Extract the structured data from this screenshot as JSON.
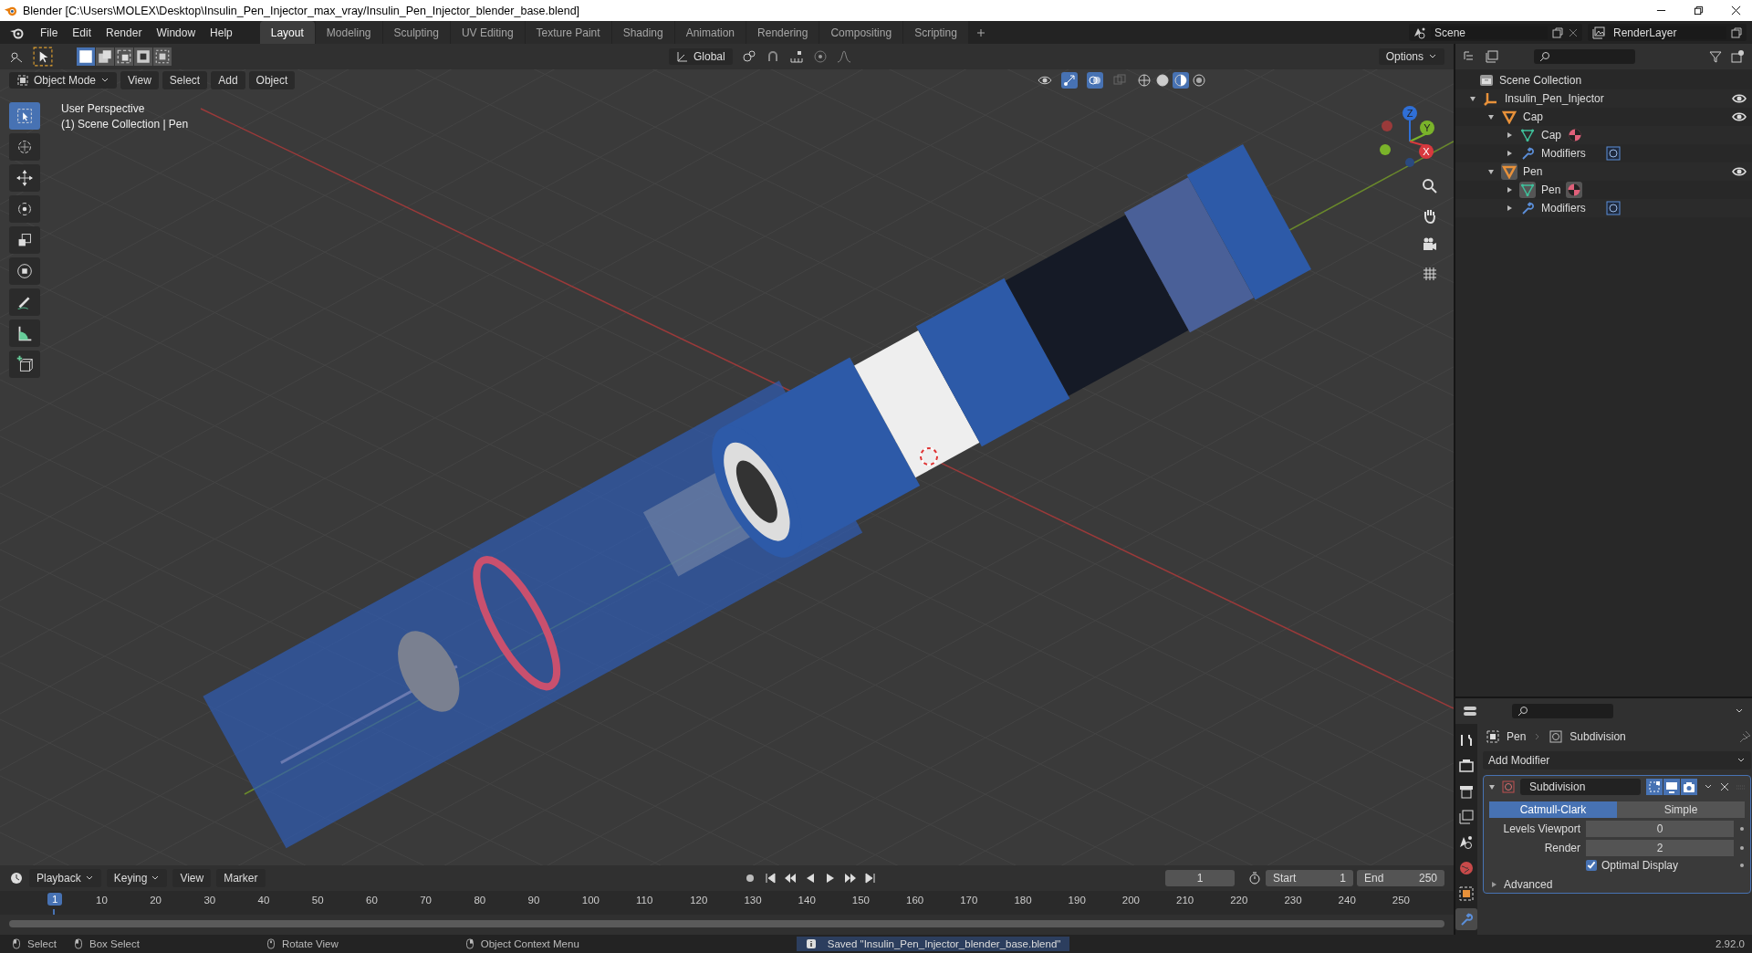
{
  "window": {
    "title": "Blender [C:\\Users\\MOLEX\\Desktop\\Insulin_Pen_Injector_max_vray/Insulin_Pen_Injector_blender_base.blend]"
  },
  "menu": [
    "File",
    "Edit",
    "Render",
    "Window",
    "Help"
  ],
  "workspace_tabs": [
    {
      "label": "Layout",
      "selected": true
    },
    {
      "label": "Modeling",
      "selected": false
    },
    {
      "label": "Sculpting",
      "selected": false
    },
    {
      "label": "UV Editing",
      "selected": false
    },
    {
      "label": "Texture Paint",
      "selected": false
    },
    {
      "label": "Shading",
      "selected": false
    },
    {
      "label": "Animation",
      "selected": false
    },
    {
      "label": "Rendering",
      "selected": false
    },
    {
      "label": "Compositing",
      "selected": false
    },
    {
      "label": "Scripting",
      "selected": false
    }
  ],
  "scene": {
    "name": "Scene"
  },
  "view_layer": {
    "name": "RenderLayer"
  },
  "tool_header": {
    "transform_orientation": "Global",
    "options_label": "Options"
  },
  "viewport": {
    "mode": "Object Mode",
    "menus": [
      "View",
      "Select",
      "Add",
      "Object"
    ],
    "info_lines": [
      "User Perspective",
      "(1) Scene Collection | Pen"
    ],
    "gizmo_labels": [
      "Z",
      "Y",
      "X"
    ],
    "shading_modes": [
      {
        "kind": "wireframe",
        "selected": false
      },
      {
        "kind": "solid",
        "selected": false
      },
      {
        "kind": "material",
        "selected": true
      },
      {
        "kind": "rendered",
        "selected": false
      }
    ],
    "tools": [
      {
        "kind": "select",
        "selected": true
      },
      {
        "kind": "cursor",
        "selected": false
      },
      {
        "kind": "move",
        "selected": false
      },
      {
        "kind": "rotate",
        "selected": false
      },
      {
        "kind": "scale",
        "selected": false
      },
      {
        "kind": "transform",
        "selected": false
      },
      {
        "kind": "annotate",
        "selected": false
      },
      {
        "kind": "measure",
        "selected": false
      },
      {
        "kind": "add-cube",
        "selected": false
      }
    ]
  },
  "outliner": {
    "root": "Scene Collection",
    "tree": [
      {
        "label": "Insulin_Pen_Injector",
        "kind": "empty",
        "expanded": true,
        "visible": true,
        "children": [
          {
            "label": "Cap",
            "kind": "mesh-object",
            "expanded": true,
            "visible": true,
            "active": false,
            "children": [
              {
                "label": "Cap",
                "kind": "mesh-data",
                "expanded": false,
                "active": false
              },
              {
                "label": "Modifiers",
                "kind": "modifiers",
                "expanded": false
              }
            ]
          },
          {
            "label": "Pen",
            "kind": "mesh-object",
            "expanded": true,
            "visible": true,
            "active": true,
            "children": [
              {
                "label": "Pen",
                "kind": "mesh-data",
                "expanded": false,
                "active": true
              },
              {
                "label": "Modifiers",
                "kind": "modifiers",
                "expanded": false
              }
            ]
          }
        ]
      }
    ]
  },
  "properties": {
    "tabs": [
      {
        "kind": "tool",
        "selected": false
      },
      {
        "kind": "render",
        "selected": false
      },
      {
        "kind": "output",
        "selected": false
      },
      {
        "kind": "view-layer",
        "selected": false
      },
      {
        "kind": "scene",
        "selected": false
      },
      {
        "kind": "world",
        "selected": false
      },
      {
        "kind": "object",
        "selected": false
      },
      {
        "kind": "modifiers",
        "selected": true
      }
    ],
    "breadcrumb": [
      "Pen",
      "Subdivision"
    ],
    "add_modifier": "Add Modifier",
    "modifier": {
      "name": "Subdivision",
      "expanded": true,
      "toggles": [
        {
          "kind": "edit-mode",
          "on": true
        },
        {
          "kind": "viewport",
          "on": true
        },
        {
          "kind": "render",
          "on": true
        }
      ],
      "types": [
        {
          "label": "Catmull-Clark",
          "selected": true
        },
        {
          "label": "Simple",
          "selected": false
        }
      ],
      "fields": [
        {
          "label": "Levels Viewport",
          "value": "0"
        },
        {
          "label": "Render",
          "value": "2"
        }
      ],
      "optimal_display": {
        "label": "Optimal Display",
        "checked": true
      },
      "advanced": {
        "label": "Advanced",
        "expanded": false
      }
    }
  },
  "timeline": {
    "menus": [
      "Playback",
      "Keying",
      "View",
      "Marker"
    ],
    "current_frame": "1",
    "start": {
      "label": "Start",
      "value": "1"
    },
    "end": {
      "label": "End",
      "value": "250"
    },
    "ruler_labels": [
      "1",
      "10",
      "20",
      "30",
      "40",
      "50",
      "60",
      "70",
      "80",
      "90",
      "100",
      "110",
      "120",
      "130",
      "140",
      "150",
      "160",
      "170",
      "180",
      "190",
      "200",
      "210",
      "220",
      "230",
      "240",
      "250"
    ]
  },
  "status_bar": {
    "hints": [
      {
        "kind": "left-click",
        "label": "Select"
      },
      {
        "kind": "drag",
        "label": "Box Select"
      },
      {
        "kind": "middle-click",
        "label": "Rotate View"
      },
      {
        "kind": "right-click",
        "label": "Object Context Menu"
      }
    ],
    "message": "Saved \"Insulin_Pen_Injector_blender_base.blend\"",
    "version": "2.92.0"
  }
}
